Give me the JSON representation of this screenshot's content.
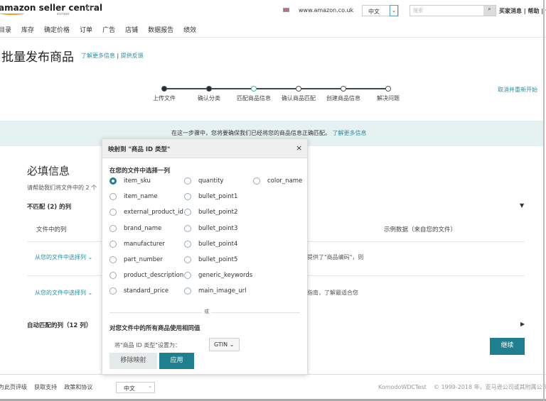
{
  "header": {
    "logo": "amazon seller central",
    "logo_region": "europe",
    "marketplace": "www.amazon.co.uk",
    "language": "中文",
    "search_placeholder": "搜索",
    "links": [
      "买家消息",
      "帮助",
      "设"
    ]
  },
  "nav": [
    "目录",
    "库存",
    "确定价格",
    "订单",
    "广告",
    "店铺",
    "数据报告",
    "绩效"
  ],
  "page": {
    "title": "批量发布商品",
    "learn_more": "了解更多信息",
    "feedback": "提供反馈",
    "separator": "|",
    "cancel_restart": "取消并重新开始"
  },
  "steps": [
    {
      "label": "上传文件",
      "state": "done"
    },
    {
      "label": "确认分类",
      "state": "done"
    },
    {
      "label": "匹配商品信息",
      "state": "current"
    },
    {
      "label": "确认商品匹配",
      "state": "todo"
    },
    {
      "label": "创建商品信息",
      "state": "todo"
    },
    {
      "label": "解决问题",
      "state": "todo"
    }
  ],
  "banner": {
    "text": "在这一步骤中，您将要确保我们已经将您的商品信息正确匹配。",
    "link": "了解更多信息"
  },
  "main": {
    "heading": "必填信息",
    "subtitle": "请帮助我们将文件中的 2 个",
    "unmatched": "不匹配 (2) 的列",
    "col_file": "文件中的列",
    "col_sample": "示例数据（来自您的文件）",
    "rows": [
      {
        "select": "从您的文件中选择列",
        "sample": "提供了\"商品编码\"，则"
      },
      {
        "select": "从您的文件中选择列",
        "sample": "指南，了解最适合您"
      }
    ],
    "auto_matched": "自动匹配的列（12 列）",
    "continue": "继续"
  },
  "modal": {
    "title": "映射到 \"商品 ID 类型\"",
    "close": "×",
    "choose_label": "在您的文件中选择一列",
    "selected": "item_sku",
    "options": [
      [
        "item_sku",
        "item_name",
        "external_product_id",
        "brand_name",
        "manufacturer",
        "part_number",
        "product_description",
        "standard_price"
      ],
      [
        "quantity",
        "bullet_point1",
        "bullet_point2",
        "bullet_point3",
        "bullet_point4",
        "bullet_point5",
        "generic_keywords",
        "main_image_url"
      ],
      [
        "color_name"
      ]
    ],
    "or": "或",
    "same_value_label": "对您文件中的所有商品使用相同值",
    "set_label": "将\"商品 ID 类型\"设置为：",
    "value": "GTIN",
    "remove": "移除映射",
    "apply": "应用"
  },
  "footer": {
    "rate": "为此页评级",
    "support": "获取支持",
    "policies": "政策和协议",
    "language": "中文",
    "user": "KomodoWDCTest",
    "copyright": "© 1999-2018 年，亚马逊公司或其附属公司"
  },
  "colors": {
    "accent": "#1f7f8e",
    "link": "#2a8ea0",
    "banner": "#e6f1f2"
  }
}
